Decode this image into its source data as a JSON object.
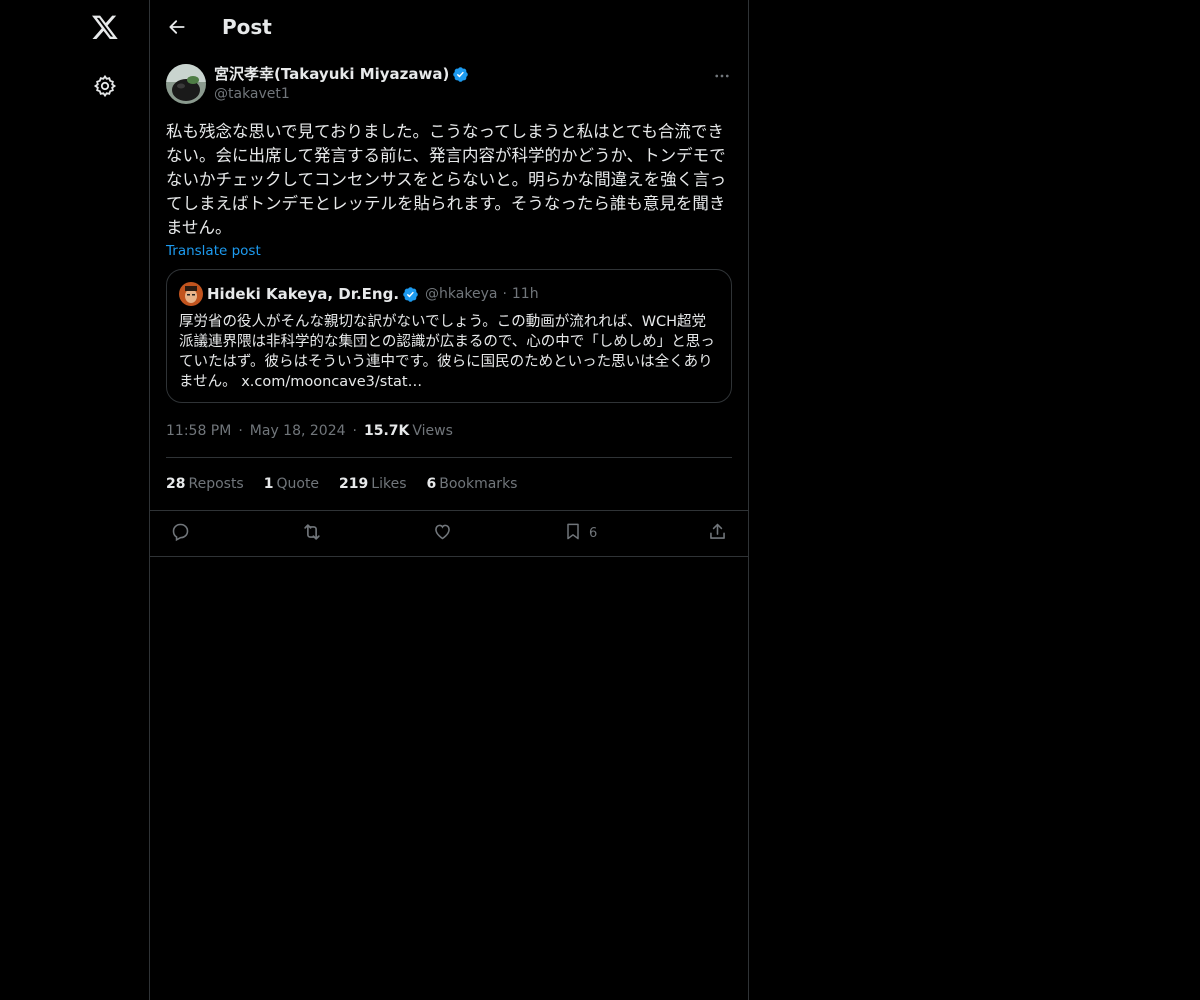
{
  "header": {
    "title": "Post"
  },
  "post": {
    "display_name": "宮沢孝幸(Takayuki Miyazawa)",
    "handle": "@takavet1",
    "text": "私も残念な思いで見ておりました。こうなってしまうと私はとても合流できない。会に出席して発言する前に、発言内容が科学的かどうか、トンデモでないかチェックしてコンセンサスをとらないと。明らかな間違えを強く言ってしまえばトンデモとレッテルを貼られます。そうなったら誰も意見を聞きません。",
    "translate_label": "Translate post",
    "time": "11:58 PM",
    "date": "May 18, 2024",
    "views_count": "15.7K",
    "views_label": "Views"
  },
  "quote": {
    "display_name": "Hideki Kakeya, Dr.Eng.",
    "handle": "@hkakeya",
    "dot": "·",
    "time": "11h",
    "text": "厚労省の役人がそんな親切な訳がないでしょう。この動画が流れれば、WCH超党派議連界隈は非科学的な集団との認識が広まるので、心の中で「しめしめ」と思っていたはず。彼らはそういう連中です。彼らに国民のためといった思いは全くありません。",
    "link": "x.com/mooncave3/stat…"
  },
  "stats": {
    "reposts_count": "28",
    "reposts_label": "Reposts",
    "quotes_count": "1",
    "quotes_label": "Quote",
    "likes_count": "219",
    "likes_label": "Likes",
    "bookmarks_count": "6",
    "bookmarks_label": "Bookmarks"
  },
  "actions": {
    "reply_icon": "reply-icon",
    "repost_icon": "repost-icon",
    "like_icon": "heart-icon",
    "bookmark_icon": "bookmark-icon",
    "bookmark_count": "6",
    "share_icon": "share-icon"
  },
  "colors": {
    "background": "#000000",
    "text": "#e7e9ea",
    "secondary": "#71767b",
    "accent": "#1d9bf0",
    "border": "#2f3336"
  }
}
